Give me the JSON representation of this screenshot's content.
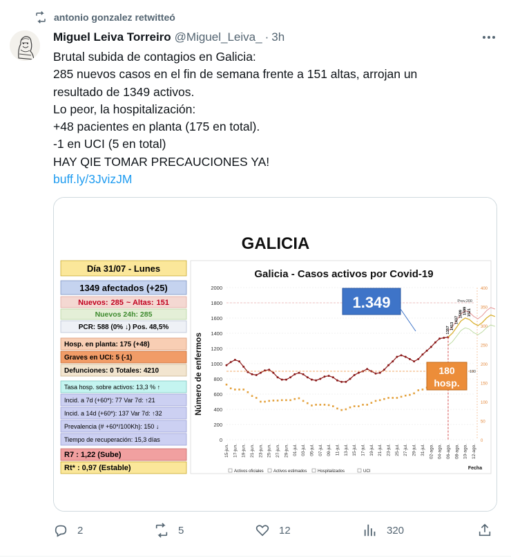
{
  "retweet": {
    "label": "antonio gonzalez retwitteó"
  },
  "tweet": {
    "name": "Miguel Leiva Torreiro",
    "handle": "@Miguel_Leiva_",
    "separator": "·",
    "time": "3h",
    "lines": [
      "Brutal subida de contagios en Galicia:",
      "285 nuevos casos en el fin de semana frente a 151 altas, arrojan un",
      "resultado de 1349 activos.",
      "Lo peor, la hospitalización:",
      "+48 pacientes en planta (175 en total).",
      "-1 en UCI (5 en total)",
      "HAY QIE TOMAR PRECAUCIONES YA!"
    ],
    "link": "buff.ly/3JvizJM"
  },
  "image": {
    "title": "GALICIA",
    "panel": {
      "day": "Día 31/07 - Lunes",
      "affected": "1349 afectados (+25)",
      "nuevos_label": "Nuevos:",
      "nuevos_value": "285",
      "altas_label": "~ Altas:",
      "altas_value": "151",
      "nuevos24": "Nuevos 24h:  285",
      "pcr": "PCR: 588  (0% ↓)  Pos. 48,5%",
      "hosp": "Hosp. en planta:  175 (+48)",
      "uci": "Graves en UCI:      5 (-1)",
      "defunciones": "Defunciones: 0     Totales: 4210",
      "tasa": "Tasa hosp. sobre activos:   13,3 %  ↑",
      "incid7": "Incid. a 7d (+60*):  77  Var 7d:  ↑21",
      "incid14": "Incid. a 14d (+60*): 137  Var 7d:  ↑32",
      "prevalencia": "Prevalencia (# +60*/100Kh):  150 ↓",
      "recuperacion": "Tiempo de recuperación: 15,3 días",
      "r7": "R7 :  1,22 (Sube)",
      "rt": "Rt* :  0,97 (Estable)"
    },
    "chart_data": {
      "type": "line",
      "title": "Galicia  -  Casos activos por Covid-19",
      "ylabel": "Número de enfermos",
      "xlabel": "Fecha",
      "ylim": [
        0,
        2000
      ],
      "y2lim": [
        0,
        400
      ],
      "yticks": [
        0,
        200,
        400,
        600,
        800,
        1000,
        1200,
        1400,
        1600,
        1800,
        2000
      ],
      "y2ticks": [
        0,
        50,
        100,
        150,
        200,
        250,
        300,
        350,
        400
      ],
      "xticks": [
        "15-jun.",
        "17-jun.",
        "19-jun.",
        "21-jun.",
        "23-jun.",
        "25-jun.",
        "27-jun.",
        "29-jun.",
        "01-jul.",
        "03-jul.",
        "05-jul.",
        "07-jul.",
        "09-jul.",
        "11-jul.",
        "13-jul.",
        "15-jul.",
        "17-jul.",
        "19-jul.",
        "21-jul.",
        "23-jul.",
        "25-jul.",
        "27-jul.",
        "29-jul.",
        "31-jul.",
        "02-ago.",
        "04-ago.",
        "06-ago.",
        "08-ago.",
        "10-ago.",
        "12-ago."
      ],
      "series": [
        {
          "name": "Activos oficiales",
          "x_start": 0,
          "x_step": 1,
          "values": [
            980,
            1020,
            1050,
            1030,
            960,
            890,
            860,
            850,
            880,
            910,
            920,
            880,
            820,
            790,
            790,
            820,
            860,
            880,
            860,
            820,
            790,
            780,
            800,
            830,
            840,
            820,
            780,
            760,
            760,
            800,
            850,
            880,
            900,
            930,
            900,
            870,
            880,
            920,
            980,
            1030,
            1090,
            1110,
            1090,
            1060,
            1030,
            1060,
            1120,
            1170,
            1220,
            1280,
            1330,
            1340,
            1349
          ]
        },
        {
          "name": "Activos estimados",
          "x_start": 52,
          "x_step": 1,
          "values": [
            1349,
            1400,
            1480,
            1560,
            1600,
            1580,
            1530,
            1500,
            1540,
            1600,
            1640,
            1620
          ]
        },
        {
          "name": "Hospitalizados",
          "axis": "right",
          "x_start": 0,
          "x_step": 1,
          "values": [
            145,
            135,
            132,
            132,
            132,
            125,
            115,
            110,
            100,
            100,
            102,
            103,
            103,
            104,
            104,
            104,
            107,
            109,
            102,
            96,
            90,
            92,
            92,
            92,
            91,
            88,
            82,
            78,
            80,
            85,
            88,
            88,
            92,
            92,
            97,
            102,
            104,
            107,
            110,
            110,
            110,
            113,
            116,
            118,
            122,
            130,
            132,
            137,
            135,
            138,
            140,
            140,
            175
          ]
        }
      ],
      "prev_label": "Prev.200",
      "point_labels": [
        "1357",
        "1413",
        "1437",
        "1599",
        "1599",
        "1521"
      ],
      "hundred_label": "100",
      "legend": [
        "Activos oficiales",
        "Activos estimados",
        "Hospitalizados",
        "UCI"
      ]
    },
    "callout_active": "1.349",
    "callout_hosp_num": "180",
    "callout_hosp_label": "hosp."
  },
  "actions": {
    "replies": "2",
    "retweets": "5",
    "likes": "12",
    "views": "320"
  },
  "colors": {
    "link": "#1d9bf0",
    "muted": "#536471",
    "day_box": "#fbe79a",
    "affected_box": "#c5d3ef",
    "nuevos_box": "#f4d8d2",
    "nuevos_text": "#c0001e",
    "green_box": "#e4efd7",
    "green_text": "#3d8a2e",
    "hosp_box": "#f8ceb4",
    "uci_box": "#f19c67",
    "info_box": "#ccd0f2",
    "tasa_box": "#c4f4f0",
    "r7_box": "#f1a0a0",
    "rt_box": "#fbe79a",
    "callout_blue": "#3e74c8",
    "callout_orange": "#ec8d39",
    "series_active": "#8b1a1a",
    "series_hosp": "#e3a03a"
  }
}
